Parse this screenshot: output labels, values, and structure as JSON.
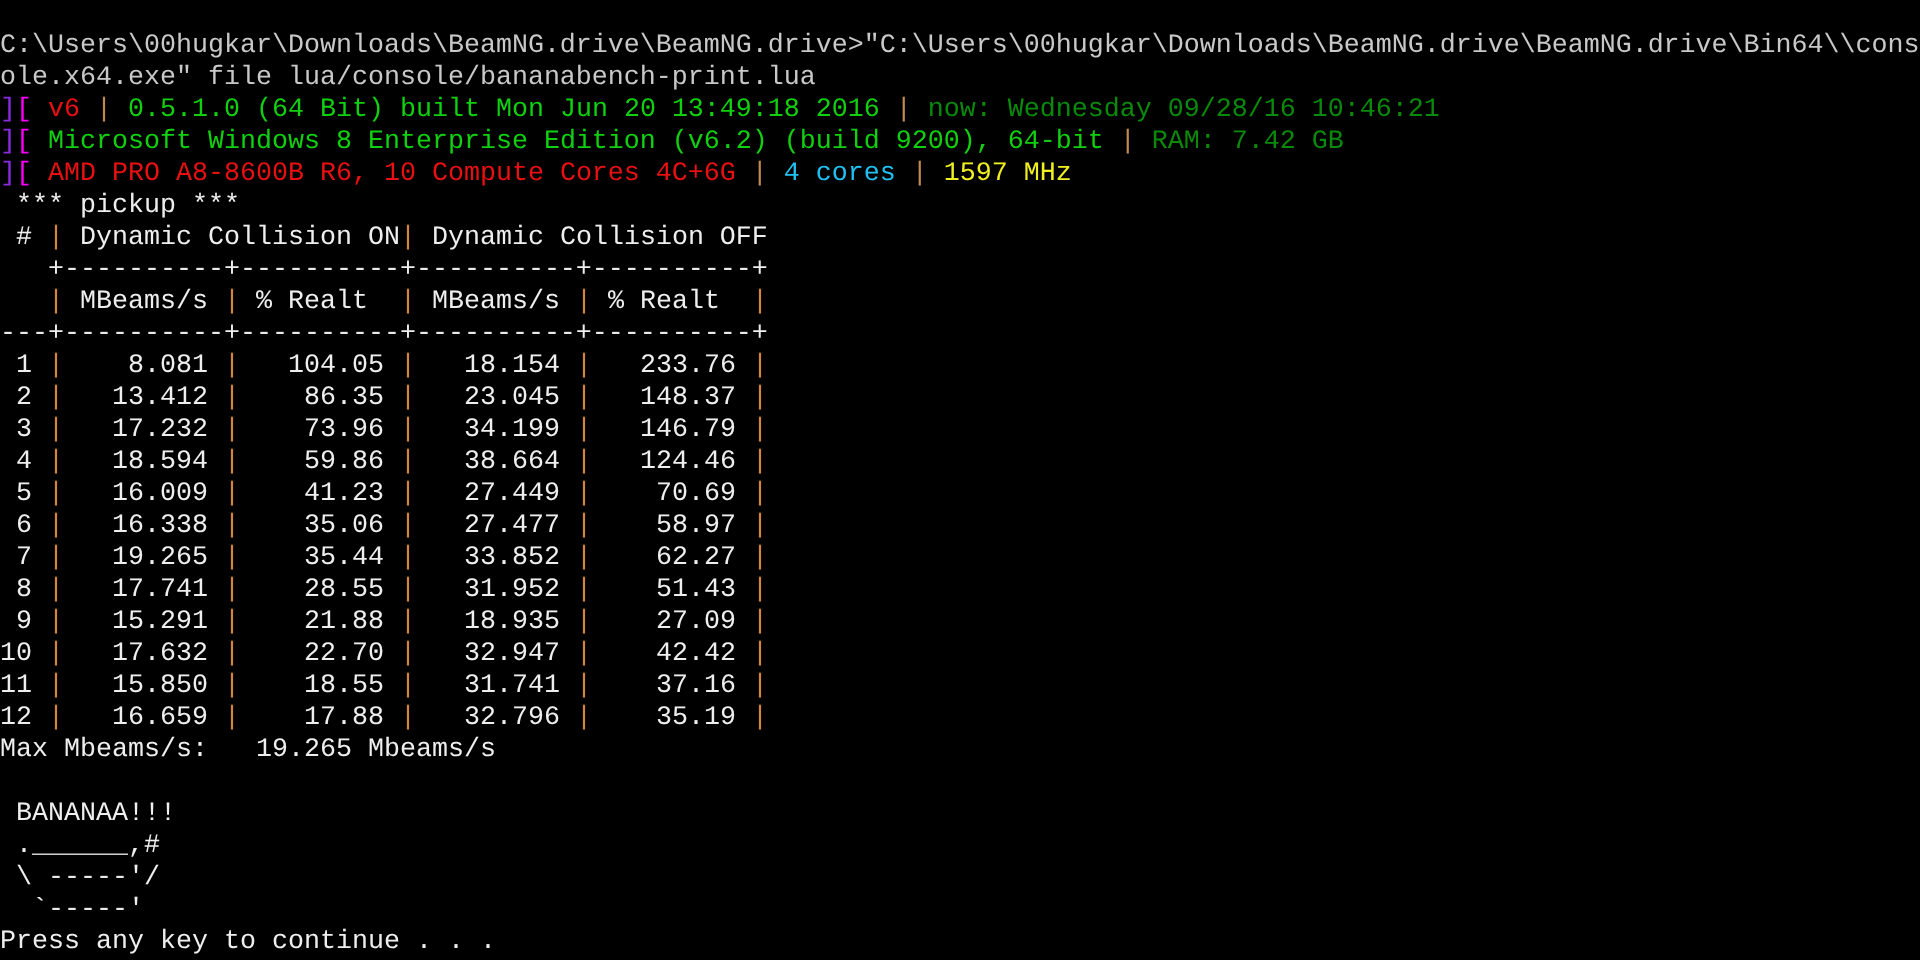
{
  "command": [
    "C:\\Users\\00hugkar\\Downloads\\BeamNG.drive\\BeamNG.drive>\"C:\\Users\\00hugkar\\Downloads\\BeamNG.drive\\BeamNG.drive\\Bin64\\\\cons",
    "ole.x64.exe\" file lua/console/bananabench-print.lua"
  ],
  "info_lines": [
    {
      "segments": [
        {
          "text": "]",
          "color": "#8a2be2"
        },
        {
          "text": "[",
          "color": "#ff00ff"
        },
        {
          "text": " v6",
          "color": "#e81010"
        },
        {
          "text": " | ",
          "color": "#c08a50"
        },
        {
          "text": "0.5.1.0 (64 Bit) built Mon Jun 20 13:49:18 2016",
          "color": "#10d010"
        },
        {
          "text": " | ",
          "color": "#c08a50"
        },
        {
          "text": "now: Wednesday 09/28/16 10:46:21",
          "color": "#0a8a0a"
        }
      ]
    },
    {
      "segments": [
        {
          "text": "]",
          "color": "#8a2be2"
        },
        {
          "text": "[",
          "color": "#ff00ff"
        },
        {
          "text": " Microsoft Windows 8 Enterprise Edition (v6.2) (build 9200), 64-bit",
          "color": "#10d010"
        },
        {
          "text": " | ",
          "color": "#c08a50"
        },
        {
          "text": "RAM: 7.42 GB",
          "color": "#0a8a0a"
        }
      ]
    },
    {
      "segments": [
        {
          "text": "]",
          "color": "#8a2be2"
        },
        {
          "text": "[",
          "color": "#ff00ff"
        },
        {
          "text": " AMD PRO A8-8600B R6, 10 Compute Cores 4C+6G",
          "color": "#e81010"
        },
        {
          "text": " | ",
          "color": "#c08a50"
        },
        {
          "text": "4 cores",
          "color": "#20c0f0"
        },
        {
          "text": " | ",
          "color": "#c08a50"
        },
        {
          "text": "1597 MHz",
          "color": "#f0f020"
        }
      ]
    }
  ],
  "benchmark": {
    "title": " *** pickup ***",
    "table_lines": [
      {
        "segments": [
          {
            "text": " # ",
            "kind": "cell"
          },
          {
            "text": "|",
            "kind": "border"
          },
          {
            "text": " Dynamic Collision ON",
            "kind": "heading"
          },
          {
            "text": "|",
            "kind": "border"
          },
          {
            "text": " Dynamic Collision OFF",
            "kind": "heading"
          }
        ]
      },
      {
        "segments": [
          {
            "text": "   +----------+----------+----------+----------+",
            "kind": "rule"
          }
        ]
      },
      {
        "segments": [
          {
            "text": "   |",
            "kind": "border"
          },
          {
            "text": " MBeams/s ",
            "kind": "heading"
          },
          {
            "text": "|",
            "kind": "border"
          },
          {
            "text": " % Realt  ",
            "kind": "heading"
          },
          {
            "text": "|",
            "kind": "border"
          },
          {
            "text": " MBeams/s ",
            "kind": "heading"
          },
          {
            "text": "|",
            "kind": "border"
          },
          {
            "text": " % Realt  ",
            "kind": "heading"
          },
          {
            "text": "|",
            "kind": "border"
          }
        ]
      },
      {
        "segments": [
          {
            "text": "---+----------+----------+----------+----------+",
            "kind": "rule"
          }
        ]
      },
      {
        "segments": [
          {
            "text": " 1 ",
            "kind": "cell"
          },
          {
            "text": "|",
            "kind": "border"
          },
          {
            "text": "    8.081 ",
            "kind": "cell"
          },
          {
            "text": "|",
            "kind": "border"
          },
          {
            "text": "   104.05 ",
            "kind": "cell"
          },
          {
            "text": "|",
            "kind": "border"
          },
          {
            "text": "   18.154 ",
            "kind": "cell"
          },
          {
            "text": "|",
            "kind": "border"
          },
          {
            "text": "   233.76 ",
            "kind": "cell"
          },
          {
            "text": "|",
            "kind": "border"
          }
        ]
      },
      {
        "segments": [
          {
            "text": " 2 ",
            "kind": "cell"
          },
          {
            "text": "|",
            "kind": "border"
          },
          {
            "text": "   13.412 ",
            "kind": "cell"
          },
          {
            "text": "|",
            "kind": "border"
          },
          {
            "text": "    86.35 ",
            "kind": "cell"
          },
          {
            "text": "|",
            "kind": "border"
          },
          {
            "text": "   23.045 ",
            "kind": "cell"
          },
          {
            "text": "|",
            "kind": "border"
          },
          {
            "text": "   148.37 ",
            "kind": "cell"
          },
          {
            "text": "|",
            "kind": "border"
          }
        ]
      },
      {
        "segments": [
          {
            "text": " 3 ",
            "kind": "cell"
          },
          {
            "text": "|",
            "kind": "border"
          },
          {
            "text": "   17.232 ",
            "kind": "cell"
          },
          {
            "text": "|",
            "kind": "border"
          },
          {
            "text": "    73.96 ",
            "kind": "cell"
          },
          {
            "text": "|",
            "kind": "border"
          },
          {
            "text": "   34.199 ",
            "kind": "cell"
          },
          {
            "text": "|",
            "kind": "border"
          },
          {
            "text": "   146.79 ",
            "kind": "cell"
          },
          {
            "text": "|",
            "kind": "border"
          }
        ]
      },
      {
        "segments": [
          {
            "text": " 4 ",
            "kind": "cell"
          },
          {
            "text": "|",
            "kind": "border"
          },
          {
            "text": "   18.594 ",
            "kind": "cell"
          },
          {
            "text": "|",
            "kind": "border"
          },
          {
            "text": "    59.86 ",
            "kind": "cell"
          },
          {
            "text": "|",
            "kind": "border"
          },
          {
            "text": "   38.664 ",
            "kind": "cell"
          },
          {
            "text": "|",
            "kind": "border"
          },
          {
            "text": "   124.46 ",
            "kind": "cell"
          },
          {
            "text": "|",
            "kind": "border"
          }
        ]
      },
      {
        "segments": [
          {
            "text": " 5 ",
            "kind": "cell"
          },
          {
            "text": "|",
            "kind": "border"
          },
          {
            "text": "   16.009 ",
            "kind": "cell"
          },
          {
            "text": "|",
            "kind": "border"
          },
          {
            "text": "    41.23 ",
            "kind": "cell"
          },
          {
            "text": "|",
            "kind": "border"
          },
          {
            "text": "   27.449 ",
            "kind": "cell"
          },
          {
            "text": "|",
            "kind": "border"
          },
          {
            "text": "    70.69 ",
            "kind": "cell"
          },
          {
            "text": "|",
            "kind": "border"
          }
        ]
      },
      {
        "segments": [
          {
            "text": " 6 ",
            "kind": "cell"
          },
          {
            "text": "|",
            "kind": "border"
          },
          {
            "text": "   16.338 ",
            "kind": "cell"
          },
          {
            "text": "|",
            "kind": "border"
          },
          {
            "text": "    35.06 ",
            "kind": "cell"
          },
          {
            "text": "|",
            "kind": "border"
          },
          {
            "text": "   27.477 ",
            "kind": "cell"
          },
          {
            "text": "|",
            "kind": "border"
          },
          {
            "text": "    58.97 ",
            "kind": "cell"
          },
          {
            "text": "|",
            "kind": "border"
          }
        ]
      },
      {
        "segments": [
          {
            "text": " 7 ",
            "kind": "cell"
          },
          {
            "text": "|",
            "kind": "border"
          },
          {
            "text": "   19.265 ",
            "kind": "cell"
          },
          {
            "text": "|",
            "kind": "border"
          },
          {
            "text": "    35.44 ",
            "kind": "cell"
          },
          {
            "text": "|",
            "kind": "border"
          },
          {
            "text": "   33.852 ",
            "kind": "cell"
          },
          {
            "text": "|",
            "kind": "border"
          },
          {
            "text": "    62.27 ",
            "kind": "cell"
          },
          {
            "text": "|",
            "kind": "border"
          }
        ]
      },
      {
        "segments": [
          {
            "text": " 8 ",
            "kind": "cell"
          },
          {
            "text": "|",
            "kind": "border"
          },
          {
            "text": "   17.741 ",
            "kind": "cell"
          },
          {
            "text": "|",
            "kind": "border"
          },
          {
            "text": "    28.55 ",
            "kind": "cell"
          },
          {
            "text": "|",
            "kind": "border"
          },
          {
            "text": "   31.952 ",
            "kind": "cell"
          },
          {
            "text": "|",
            "kind": "border"
          },
          {
            "text": "    51.43 ",
            "kind": "cell"
          },
          {
            "text": "|",
            "kind": "border"
          }
        ]
      },
      {
        "segments": [
          {
            "text": " 9 ",
            "kind": "cell"
          },
          {
            "text": "|",
            "kind": "border"
          },
          {
            "text": "   15.291 ",
            "kind": "cell"
          },
          {
            "text": "|",
            "kind": "border"
          },
          {
            "text": "    21.88 ",
            "kind": "cell"
          },
          {
            "text": "|",
            "kind": "border"
          },
          {
            "text": "   18.935 ",
            "kind": "cell"
          },
          {
            "text": "|",
            "kind": "border"
          },
          {
            "text": "    27.09 ",
            "kind": "cell"
          },
          {
            "text": "|",
            "kind": "border"
          }
        ]
      },
      {
        "segments": [
          {
            "text": "10 ",
            "kind": "cell"
          },
          {
            "text": "|",
            "kind": "border"
          },
          {
            "text": "   17.632 ",
            "kind": "cell"
          },
          {
            "text": "|",
            "kind": "border"
          },
          {
            "text": "    22.70 ",
            "kind": "cell"
          },
          {
            "text": "|",
            "kind": "border"
          },
          {
            "text": "   32.947 ",
            "kind": "cell"
          },
          {
            "text": "|",
            "kind": "border"
          },
          {
            "text": "    42.42 ",
            "kind": "cell"
          },
          {
            "text": "|",
            "kind": "border"
          }
        ]
      },
      {
        "segments": [
          {
            "text": "11 ",
            "kind": "cell"
          },
          {
            "text": "|",
            "kind": "border"
          },
          {
            "text": "   15.850 ",
            "kind": "cell"
          },
          {
            "text": "|",
            "kind": "border"
          },
          {
            "text": "    18.55 ",
            "kind": "cell"
          },
          {
            "text": "|",
            "kind": "border"
          },
          {
            "text": "   31.741 ",
            "kind": "cell"
          },
          {
            "text": "|",
            "kind": "border"
          },
          {
            "text": "    37.16 ",
            "kind": "cell"
          },
          {
            "text": "|",
            "kind": "border"
          }
        ]
      },
      {
        "segments": [
          {
            "text": "12 ",
            "kind": "cell"
          },
          {
            "text": "|",
            "kind": "border"
          },
          {
            "text": "   16.659 ",
            "kind": "cell"
          },
          {
            "text": "|",
            "kind": "border"
          },
          {
            "text": "    17.88 ",
            "kind": "cell"
          },
          {
            "text": "|",
            "kind": "border"
          },
          {
            "text": "   32.796 ",
            "kind": "cell"
          },
          {
            "text": "|",
            "kind": "border"
          },
          {
            "text": "    35.19 ",
            "kind": "cell"
          },
          {
            "text": "|",
            "kind": "border"
          }
        ]
      }
    ],
    "max_line": "Max Mbeams/s:   19.265 Mbeams/s"
  },
  "art": [
    " BANANAA!!!",
    " .______,#",
    " \\ -----'/",
    "  `-----'"
  ],
  "prompt": "Press any key to continue . . ."
}
